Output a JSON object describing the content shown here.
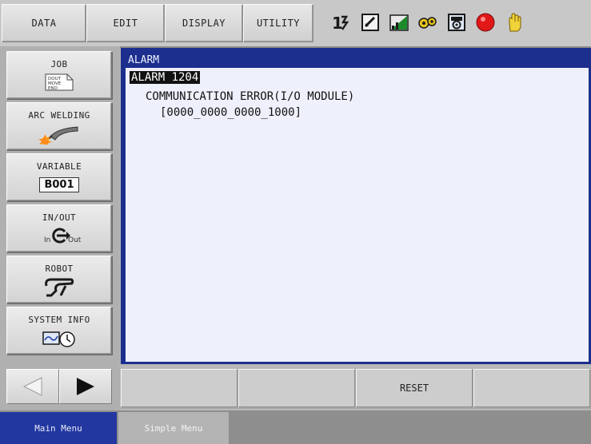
{
  "menu": {
    "items": [
      {
        "label": "DATA"
      },
      {
        "label": "EDIT"
      },
      {
        "label": "DISPLAY"
      },
      {
        "label": "UTILITY"
      }
    ]
  },
  "status_icons": [
    "coord-mode-icon",
    "edit-lock-icon",
    "speed-level-icon",
    "security-key-icon",
    "teach-mode-icon",
    "servo-status-icon",
    "hand-operation-icon"
  ],
  "sidebar": {
    "items": [
      {
        "label": "JOB",
        "icon": "job-icon",
        "icon_text": "DOUT MOVE END"
      },
      {
        "label": "ARC WELDING",
        "icon": "welding-torch-icon"
      },
      {
        "label": "VARIABLE",
        "icon": "variable-icon",
        "icon_text": "B001"
      },
      {
        "label": "IN/OUT",
        "icon": "in-out-icon",
        "icon_in": "In",
        "icon_out": "Out"
      },
      {
        "label": "ROBOT",
        "icon": "robot-icon"
      },
      {
        "label": "SYSTEM INFO",
        "icon": "system-info-icon"
      }
    ]
  },
  "main": {
    "title": "ALARM",
    "alarm": "ALARM 1204",
    "message": "COMMUNICATION ERROR(I/O MODULE)",
    "code": "[0000_0000_0000_1000]"
  },
  "softkeys": [
    "",
    "",
    "RESET",
    ""
  ],
  "tabs": [
    {
      "label": "Main Menu"
    },
    {
      "label": "Simple Menu"
    }
  ],
  "colors": {
    "accent": "#1c2f8e",
    "content_bg": "#eef0fb",
    "tab_active": "#2237a0",
    "servo_red": "#e01818"
  }
}
